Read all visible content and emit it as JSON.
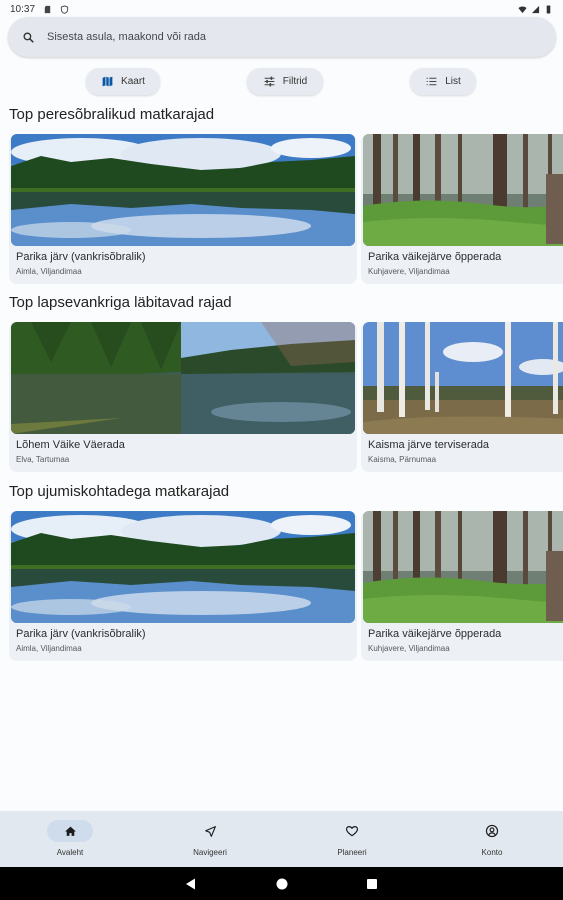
{
  "status": {
    "time": "10:37"
  },
  "search": {
    "placeholder": "Sisesta asula, maakond või rada"
  },
  "chips": {
    "map": "Kaart",
    "filters": "Filtrid",
    "list": "List"
  },
  "sections": [
    {
      "title": "Top peresõbralikud matkarajad",
      "cards": [
        {
          "title": "Parika järv (vankrisõbralik)",
          "subtitle": "Aimla, Viljandimaa"
        },
        {
          "title": "Parika väikejärve õpperada",
          "subtitle": "Kuhjavere, Viljandimaa"
        }
      ]
    },
    {
      "title": "Top lapsevankriga läbitavad rajad",
      "cards": [
        {
          "title": "Lõhem Väike Väerada",
          "subtitle": "Elva, Tartumaa"
        },
        {
          "title": "Kaisma järve terviserada",
          "subtitle": "Kaisma, Pärnumaa"
        }
      ]
    },
    {
      "title": "Top ujumiskohtadega matkarajad",
      "cards": [
        {
          "title": "Parika järv (vankrisõbralik)",
          "subtitle": "Aimla, Viljandimaa"
        },
        {
          "title": "Parika väikejärve õpperada",
          "subtitle": "Kuhjavere, Viljandimaa"
        }
      ]
    }
  ],
  "bottom_nav": {
    "items": [
      {
        "label": "Avaleht",
        "icon": "home-icon",
        "active": true
      },
      {
        "label": "Navigeeri",
        "icon": "navigate-icon",
        "active": false
      },
      {
        "label": "Planeeri",
        "icon": "heart-icon",
        "active": false
      },
      {
        "label": "Konto",
        "icon": "account-icon",
        "active": false
      }
    ]
  },
  "colors": {
    "background": "#fbfcfe",
    "search_bar": "#e4e8ee",
    "card": "#edf1f6",
    "nav_bar": "#e2e8ef",
    "nav_active_pill": "#cfdcec"
  }
}
